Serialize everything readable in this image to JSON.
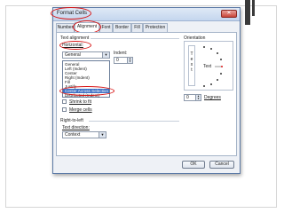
{
  "dialog": {
    "title": "Format Cells",
    "close_glyph": "✕",
    "tabs": [
      {
        "label": "Number"
      },
      {
        "label": "Alignment"
      },
      {
        "label": "Font"
      },
      {
        "label": "Border"
      },
      {
        "label": "Fill"
      },
      {
        "label": "Protection"
      }
    ],
    "active_tab": "Alignment"
  },
  "text_alignment": {
    "group_label": "Text alignment",
    "horizontal_label": "Horizontal:",
    "horizontal_value": "General",
    "horizontal_options": [
      "General",
      "Left (Indent)",
      "Center",
      "Right (Indent)",
      "Fill",
      "Justify",
      "Center Across Selection",
      "Distributed (Indent)"
    ],
    "selected_option": "Center Across Selection",
    "indent_label": "Indent:",
    "indent_value": "0"
  },
  "text_control": {
    "shrink_label": "Shrink to fit",
    "merge_label": "Merge cells"
  },
  "right_to_left": {
    "group_label": "Right-to-left",
    "direction_label": "Text direction:",
    "direction_value": "Context"
  },
  "orientation": {
    "group_label": "Orientation",
    "vertical_text": "T\ne\nx\nt",
    "dial_label": "Text",
    "degrees_value": "0",
    "degrees_label": "Degrees"
  },
  "buttons": {
    "ok": "OK",
    "cancel": "Cancel"
  },
  "colors": {
    "highlight_ring": "#d81414",
    "selection": "#3a6fc4"
  }
}
